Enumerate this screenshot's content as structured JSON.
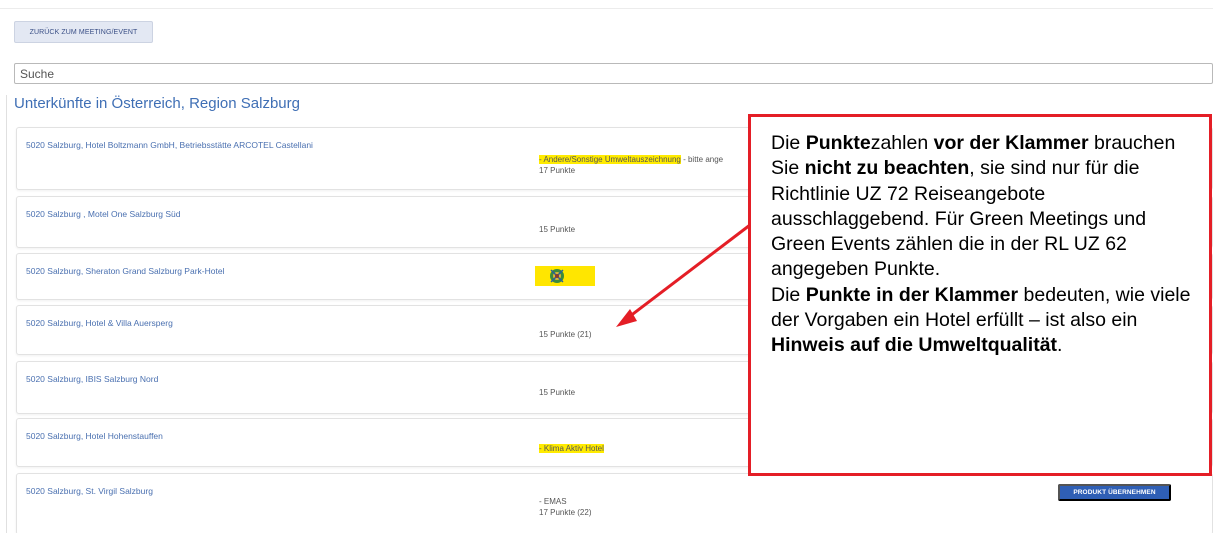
{
  "toolbar": {
    "back_label": "ZURÜCK ZUM MEETING/EVENT"
  },
  "search": {
    "placeholder": "Suche"
  },
  "section": {
    "title": "Unterkünfte in Österreich, Region Salzburg"
  },
  "hotels": [
    {
      "name": "5020 Salzburg, Hotel Boltzmann GmbH, Betriebsstätte ARCOTEL Castellani",
      "label": "- Andere/Sonstige Umweltauszeichnung",
      "label_rest": " - bitte ange",
      "points": "17 Punkte"
    },
    {
      "name": "5020 Salzburg , Motel One Salzburg Süd",
      "points": "15 Punkte"
    },
    {
      "name": "5020 Salzburg, Sheraton Grand Salzburg Park-Hotel",
      "logo": "eco-label-icon"
    },
    {
      "name": "5020 Salzburg, Hotel & Villa Auersperg",
      "points": "15 Punkte (21)"
    },
    {
      "name": "5020 Salzburg, IBIS Salzburg Nord",
      "points": "15 Punkte"
    },
    {
      "name": "5020 Salzburg, Hotel Hohenstauffen",
      "label": "- Klima Aktiv Hotel"
    },
    {
      "name": "5020 Salzburg, St. Virgil Salzburg",
      "label": "- EMAS",
      "points": "17 Punkte (22)"
    }
  ],
  "actions": {
    "take_product": "PRODUKT ÜBERNEHMEN"
  },
  "annotation": {
    "p1_a": "Die ",
    "p1_b": "Punkte",
    "p1_c": "zahlen ",
    "p1_d": "vor der Klammer",
    "p1_e": " brauchen Sie ",
    "p1_f": "nicht zu beachten",
    "p1_g": ", sie sind nur für die Richtlinie UZ 72 Reiseangebote ausschlaggebend. Für Green Meetings und Green Events zählen die in der RL UZ 62 angegeben Punkte.",
    "p2_a": "Die ",
    "p2_b": "Punkte in der Klammer",
    "p2_c": " bedeuten, wie viele der Vorgaben ein Hotel erfüllt – ist also ein ",
    "p2_d": "Hinweis auf die Umweltqualität",
    "p2_e": "."
  },
  "colors": {
    "accent": "#3f6fb5",
    "highlight": "#ffeb00",
    "annotation_border": "#e41e26",
    "button": "#2f5fb5"
  }
}
